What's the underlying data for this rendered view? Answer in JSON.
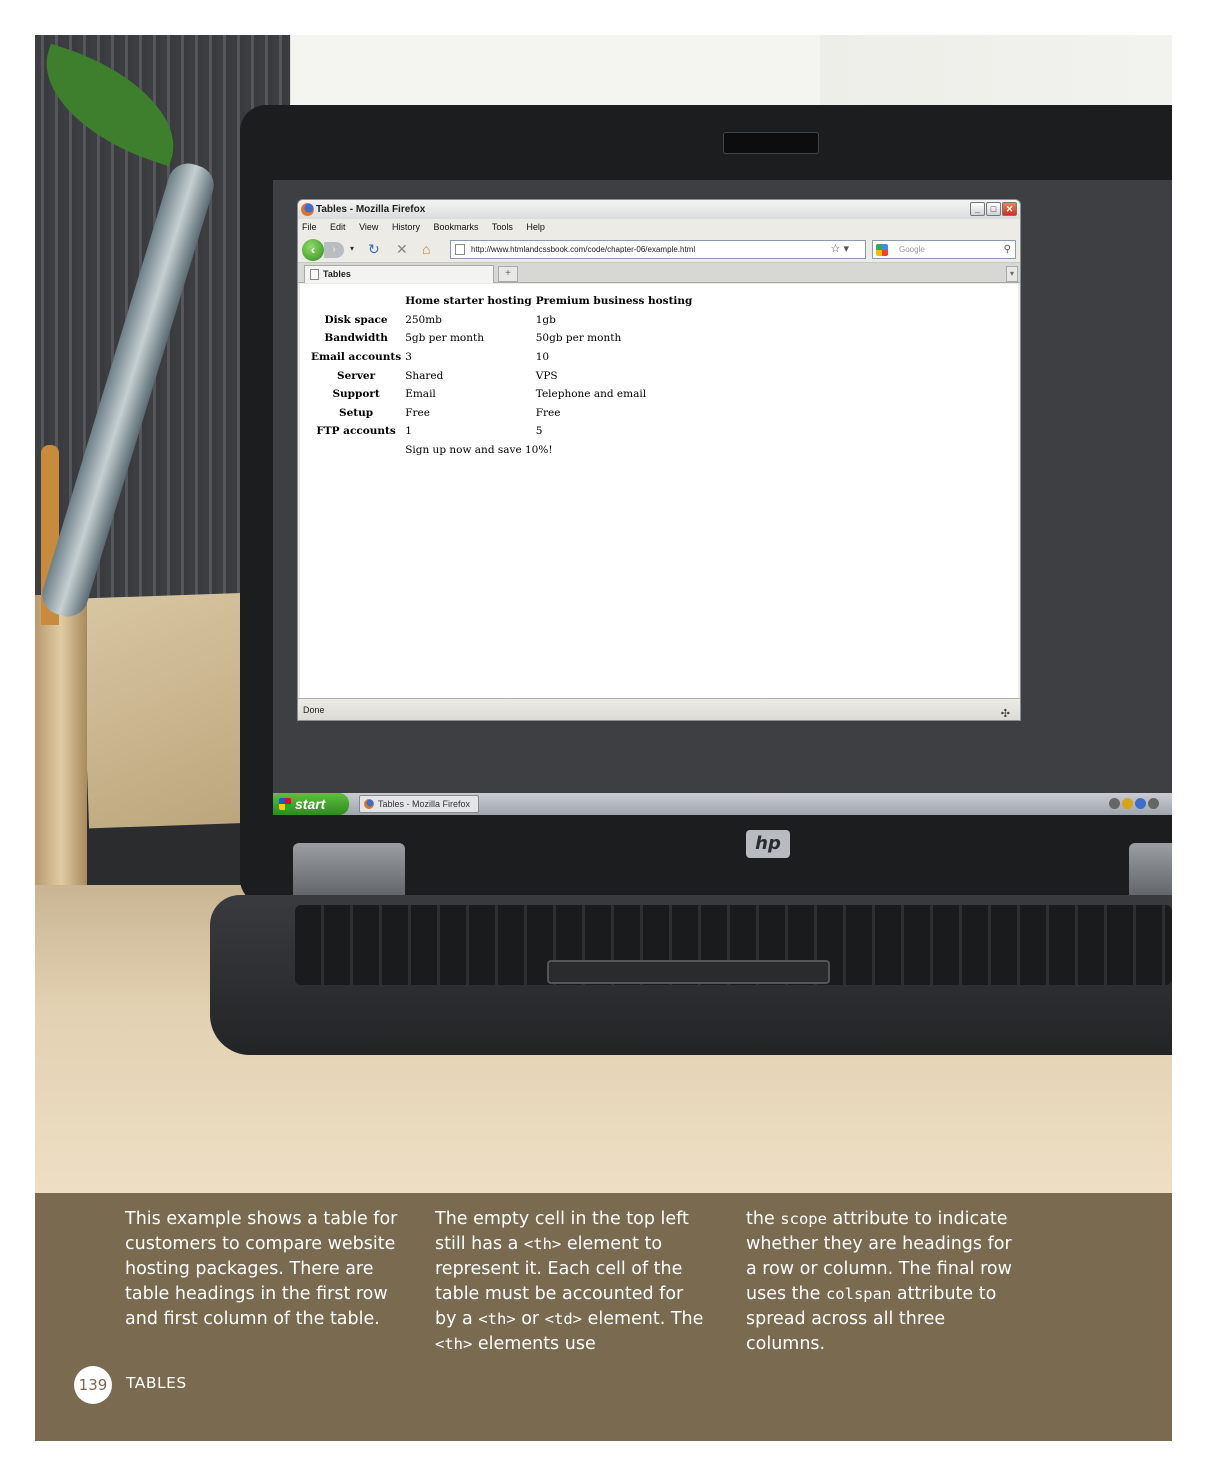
{
  "browser": {
    "title": "Tables - Mozilla Firefox",
    "menu": [
      "File",
      "Edit",
      "View",
      "History",
      "Bookmarks",
      "Tools",
      "Help"
    ],
    "url": "http://www.htmlandcssbook.com/code/chapter-06/example.html",
    "search_placeholder": "Google",
    "tab_title": "Tables",
    "status": "Done"
  },
  "taskbar": {
    "start_label": "start",
    "task_label": "Tables - Mozilla Firefox"
  },
  "laptop_brand": "hp",
  "table": {
    "col_headers": [
      "",
      "Home starter hosting",
      "Premium business hosting"
    ],
    "rows": [
      {
        "head": "Disk space",
        "c1": "250mb",
        "c2": "1gb"
      },
      {
        "head": "Bandwidth",
        "c1": "5gb per month",
        "c2": "50gb per month"
      },
      {
        "head": "Email accounts",
        "c1": "3",
        "c2": "10"
      },
      {
        "head": "Server",
        "c1": "Shared",
        "c2": "VPS"
      },
      {
        "head": "Support",
        "c1": "Email",
        "c2": "Telephone and email"
      },
      {
        "head": "Setup",
        "c1": "Free",
        "c2": "Free"
      },
      {
        "head": "FTP accounts",
        "c1": "1",
        "c2": "5"
      }
    ],
    "footer": "Sign up now and save 10%!"
  },
  "caption": {
    "col1": "This example shows a table for customers to compare website hosting packages. There are table headings in the first row and first column of the table.",
    "col2_a": "The empty cell in the top left still has a ",
    "col2_code1": "<th>",
    "col2_b": " element to represent it. Each cell of the table must be accounted for by a ",
    "col2_code2": "<th>",
    "col2_c": " or ",
    "col2_code3": "<td>",
    "col2_d": " element. The ",
    "col2_code4": "<th>",
    "col2_e": " elements use",
    "col3_a": "the ",
    "col3_code1": "scope",
    "col3_b": " attribute to indicate whether they are headings for a row or column. The final row uses the ",
    "col3_code2": "colspan",
    "col3_c": " attribute to spread across all three columns."
  },
  "page_number": "139",
  "chapter_title": "TABLES"
}
